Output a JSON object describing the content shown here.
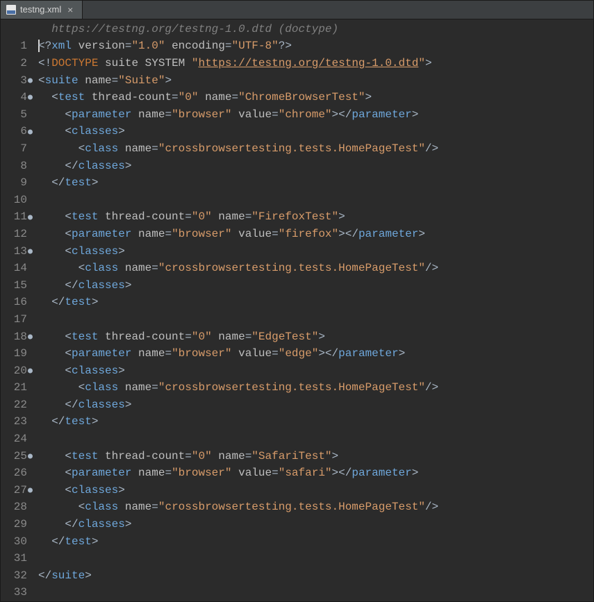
{
  "tab": {
    "filename": "testng.xml",
    "close": "×"
  },
  "hint": "https://testng.org/testng-1.0.dtd (doctype)",
  "line_numbers": [
    "1",
    "2",
    "3",
    "4",
    "5",
    "6",
    "7",
    "8",
    "9",
    "10",
    "11",
    "12",
    "13",
    "14",
    "15",
    "16",
    "17",
    "18",
    "19",
    "20",
    "21",
    "22",
    "23",
    "24",
    "25",
    "26",
    "27",
    "28",
    "29",
    "30",
    "31",
    "32",
    "33"
  ],
  "fold_lines": [
    3,
    4,
    6,
    11,
    13,
    18,
    20,
    25,
    27
  ],
  "code": {
    "xml_decl": {
      "tag": "xml",
      "attrs": [
        [
          "version",
          "1.0"
        ],
        [
          "encoding",
          "UTF-8"
        ]
      ]
    },
    "doctype": {
      "kw": "DOCTYPE",
      "root": "suite",
      "sys": "SYSTEM",
      "dtd": "https://testng.org/testng-1.0.dtd"
    },
    "suite": {
      "tag": "suite",
      "name_attr": "name",
      "name_val": "Suite"
    },
    "tests": [
      {
        "tag": "test",
        "tc_attr": "thread-count",
        "tc_val": "0",
        "name_attr": "name",
        "name_val": "ChromeBrowserTest",
        "param": {
          "tag": "parameter",
          "name_attr": "name",
          "name_val": "browser",
          "value_attr": "value",
          "value_val": "chrome"
        },
        "classes": {
          "tag": "classes"
        },
        "class": {
          "tag": "class",
          "name_attr": "name",
          "name_val": "crossbrowsertesting.tests.HomePageTest"
        }
      },
      {
        "tag": "test",
        "tc_attr": "thread-count",
        "tc_val": "0",
        "name_attr": "name",
        "name_val": "FirefoxTest",
        "param": {
          "tag": "parameter",
          "name_attr": "name",
          "name_val": "browser",
          "value_attr": "value",
          "value_val": "firefox"
        },
        "classes": {
          "tag": "classes"
        },
        "class": {
          "tag": "class",
          "name_attr": "name",
          "name_val": "crossbrowsertesting.tests.HomePageTest"
        }
      },
      {
        "tag": "test",
        "tc_attr": "thread-count",
        "tc_val": "0",
        "name_attr": "name",
        "name_val": "EdgeTest",
        "param": {
          "tag": "parameter",
          "name_attr": "name",
          "name_val": "browser",
          "value_attr": "value",
          "value_val": "edge"
        },
        "classes": {
          "tag": "classes"
        },
        "class": {
          "tag": "class",
          "name_attr": "name",
          "name_val": "crossbrowsertesting.tests.HomePageTest"
        }
      },
      {
        "tag": "test",
        "tc_attr": "thread-count",
        "tc_val": "0",
        "name_attr": "name",
        "name_val": "SafariTest",
        "param": {
          "tag": "parameter",
          "name_attr": "name",
          "name_val": "browser",
          "value_attr": "value",
          "value_val": "safari"
        },
        "classes": {
          "tag": "classes"
        },
        "class": {
          "tag": "class",
          "name_attr": "name",
          "name_val": "crossbrowsertesting.tests.HomePageTest"
        }
      }
    ]
  }
}
